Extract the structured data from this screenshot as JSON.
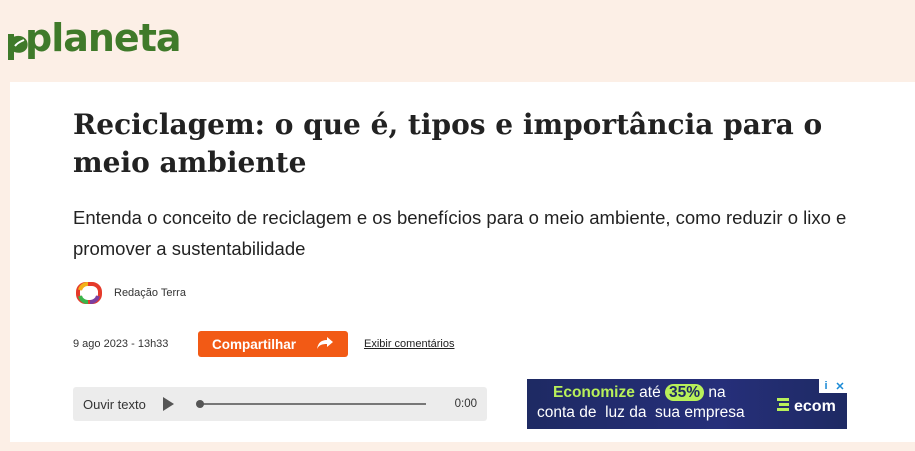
{
  "site": {
    "logo_text": "planeta",
    "logo_color": "#3f7a2a"
  },
  "article": {
    "title": "Reciclagem: o que é, tipos e importância para o meio ambiente",
    "subtitle": "Entenda o conceito de reciclagem e os benefícios para o meio ambiente, como reduzir o lixo e promover a sustentabilidade",
    "author": "Redação Terra",
    "date": "9 ago 2023 - 13h33"
  },
  "actions": {
    "share_label": "Compartilhar",
    "share_color": "#f25a15",
    "comments_label": "Exibir comentários"
  },
  "audio": {
    "label": "Ouvir texto",
    "time": "0:00",
    "progress": 0
  },
  "ad": {
    "word1": "Economize",
    "word2": "até",
    "percent": "35%",
    "word3": "na",
    "line2": "conta de  luz da  sua empresa",
    "brand": "ecom"
  }
}
